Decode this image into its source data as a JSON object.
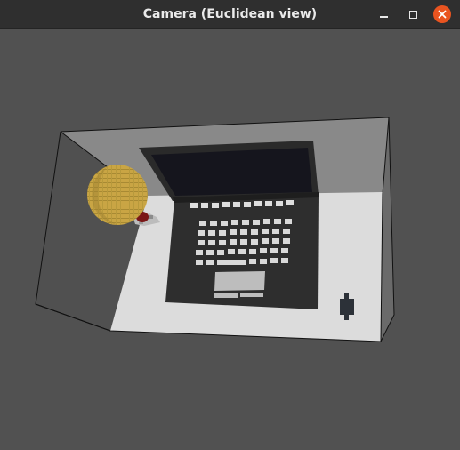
{
  "window": {
    "title": "Camera (Euclidean view)"
  },
  "titlebar": {
    "buttons": [
      {
        "name": "minimize",
        "icon": "minimize-icon"
      },
      {
        "name": "maximize",
        "icon": "maximize-icon"
      },
      {
        "name": "close",
        "icon": "close-icon"
      }
    ]
  },
  "colors": {
    "titlebar": "#2f2f2f",
    "viewport_background": "#515151",
    "close_button": "#e95420",
    "floor": "#dcdcdc",
    "back_wall": "#888888",
    "laptop_body": "#2b2b2b",
    "laptop_screen": "#111118",
    "keys": "#dddddd",
    "ball": "#c9a544",
    "stain": "#7a1717"
  }
}
